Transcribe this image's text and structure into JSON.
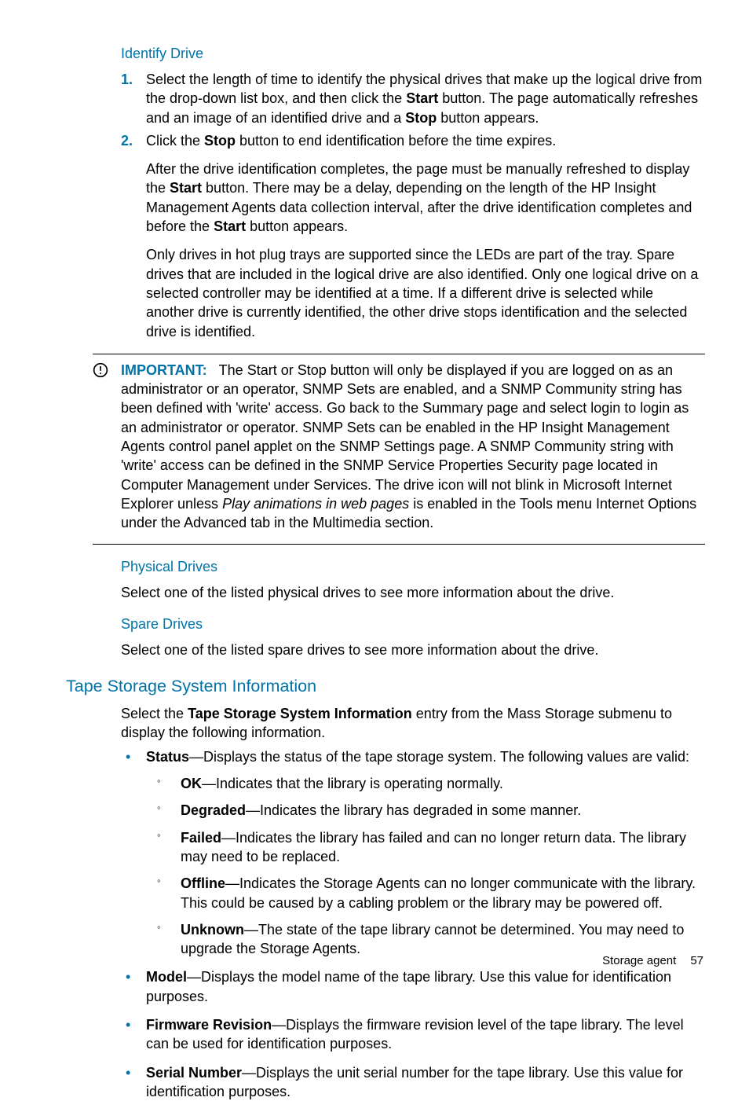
{
  "identify": {
    "heading": "Identify Drive",
    "step1_a": "Select the length of time to identify the physical drives that make up the logical drive from the drop-down list box, and then click the ",
    "step1_b": " button. The page automatically refreshes and an image of an identified drive and a ",
    "step1_c": " button appears.",
    "start": "Start",
    "stop": "Stop",
    "step2_a": "Click the ",
    "step2_b": " button to end identification before the time expires.",
    "step2_follow1_a": "After the drive identification completes, the page must be manually refreshed to display the ",
    "step2_follow1_b": " button. There may be a delay, depending on the length of the HP Insight Management Agents data collection interval, after the drive identification completes and before the ",
    "step2_follow1_c": " button appears.",
    "step2_follow2": "Only drives in hot plug trays are supported since the LEDs are part of the tray. Spare drives that are included in the logical drive are also identified. Only one logical drive on a selected controller may be identified at a time. If a different drive is selected while another drive is currently identified, the other drive stops identification and the selected drive is identified."
  },
  "important": {
    "label": "IMPORTANT:",
    "text_a": "The Start or Stop button will only be displayed if you are logged on as an administrator or an operator, SNMP Sets are enabled, and a SNMP Community string has been defined with 'write' access. Go back to the Summary page and select login to login as an administrator or operator. SNMP Sets can be enabled in the HP Insight Management Agents control panel applet on the SNMP Settings page. A SNMP Community string with 'write' access can be defined in the SNMP Service Properties Security page located in Computer Management under Services. The drive icon will not blink in Microsoft Internet Explorer unless ",
    "text_italic": "Play animations in web pages",
    "text_b": " is enabled in the Tools menu Internet Options under the Advanced tab in the Multimedia section."
  },
  "physical": {
    "heading": "Physical Drives",
    "text": "Select one of the listed physical drives to see more information about the drive."
  },
  "spare": {
    "heading": "Spare Drives",
    "text": "Select one of the listed spare drives to see more information about the drive."
  },
  "tape": {
    "heading": "Tape Storage System Information",
    "intro_a": "Select the ",
    "intro_bold": "Tape Storage System Information",
    "intro_b": " entry from the Mass Storage submenu to display the following information.",
    "status": {
      "label": "Status",
      "text": "—Displays the status of the tape storage system. The following values are valid:",
      "ok_label": "OK",
      "ok_text": "—Indicates that the library is operating normally.",
      "degraded_label": "Degraded",
      "degraded_text": "—Indicates the library has degraded in some manner.",
      "failed_label": "Failed",
      "failed_text": "—Indicates the library has failed and can no longer return data. The library may need to be replaced.",
      "offline_label": "Offline",
      "offline_text": "—Indicates the Storage Agents can no longer communicate with the library. This could be caused by a cabling problem or the library may be powered off.",
      "unknown_label": "Unknown",
      "unknown_text": "—The state of the tape library cannot be determined. You may need to upgrade the Storage Agents."
    },
    "model": {
      "label": "Model",
      "text": "—Displays the model name of the tape library. Use this value for identification purposes."
    },
    "firmware": {
      "label": "Firmware Revision",
      "text": "—Displays the firmware revision level of the tape library. The level can be used for identification purposes."
    },
    "serial": {
      "label": "Serial Number",
      "text": "—Displays the unit serial number for the tape library. Use this value for identification purposes."
    }
  },
  "footer": {
    "section": "Storage agent",
    "page": "57"
  }
}
